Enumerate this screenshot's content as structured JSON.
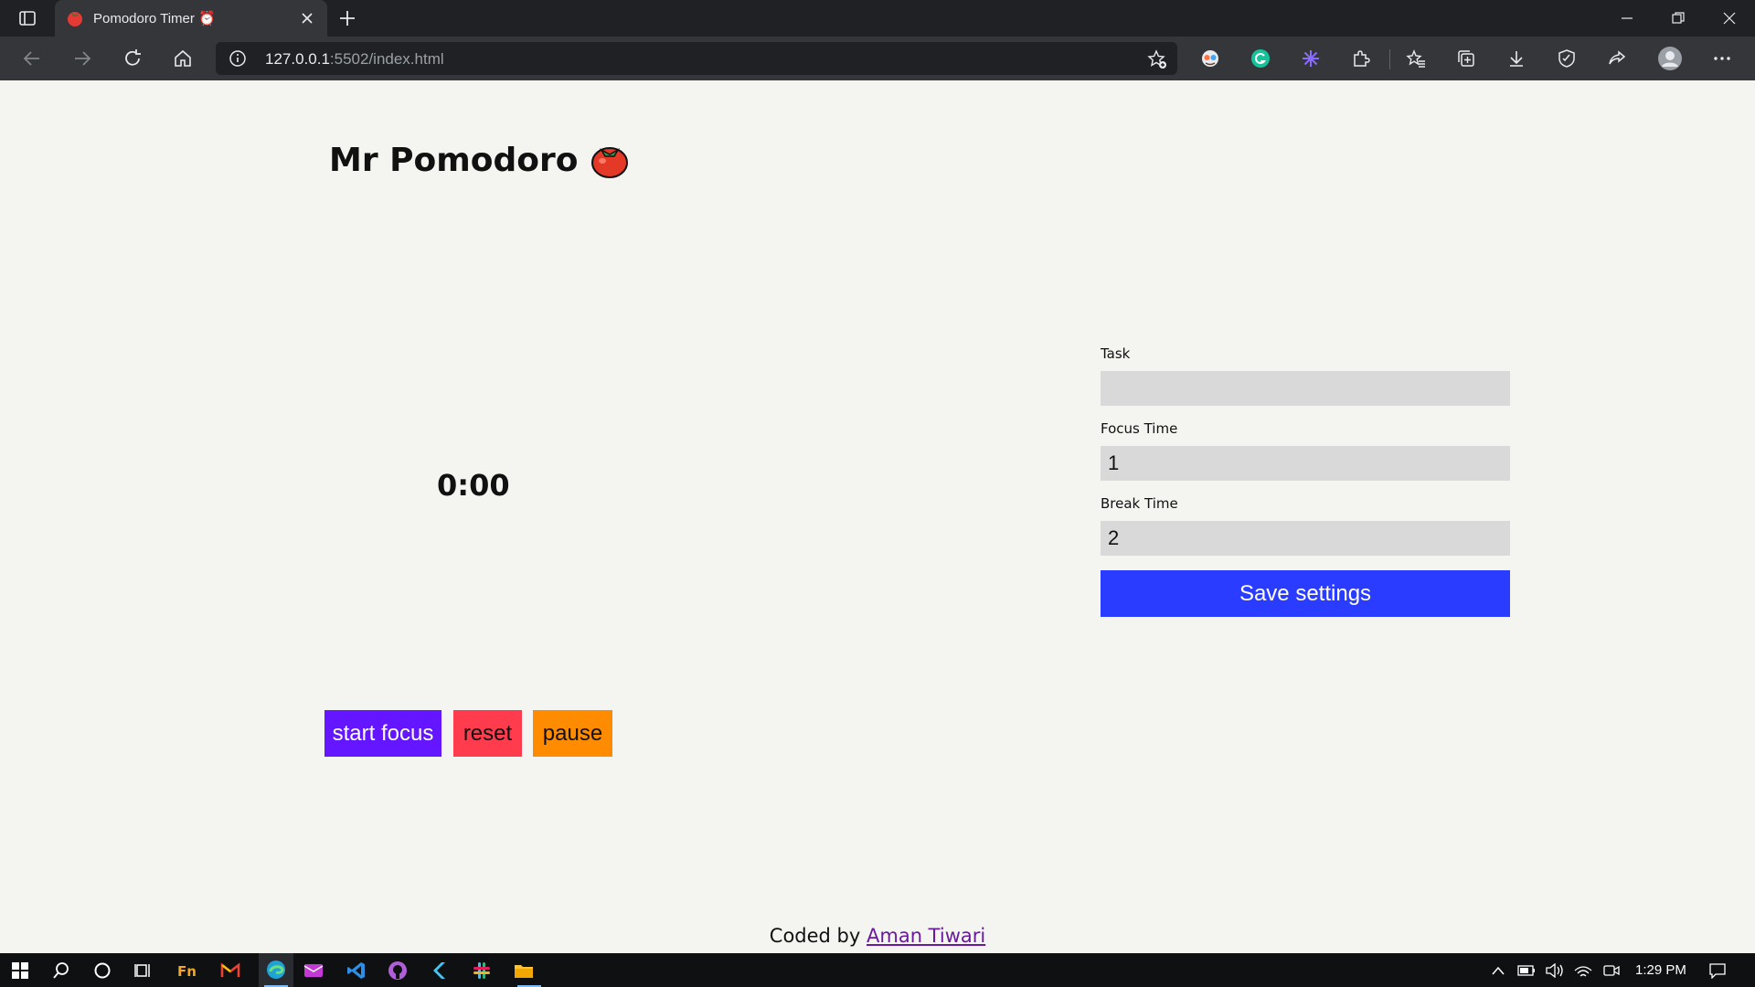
{
  "browser": {
    "tab_title": "Pomodoro Timer ⏰",
    "url_host": "127.0.0.1",
    "url_rest": ":5502/index.html"
  },
  "app": {
    "title": "Mr Pomodoro",
    "timer": "0:00",
    "buttons": {
      "start": "start focus",
      "reset": "reset",
      "pause": "pause"
    },
    "settings": {
      "task_label": "Task",
      "task_value": "",
      "focus_label": "Focus Time",
      "focus_value": "1",
      "break_label": "Break Time",
      "break_value": "2",
      "save_label": "Save settings"
    },
    "footer": {
      "prefix": "Coded by",
      "author": "Aman Tiwari"
    },
    "colors": {
      "start": "#6316ff",
      "reset": "#ff3b4e",
      "pause": "#ff8c00",
      "save": "#2a3cff"
    }
  },
  "taskbar": {
    "time": "1:29 PM"
  },
  "icons": [
    "tab-actions-icon",
    "tomato-icon",
    "close-icon",
    "plus-icon",
    "minimize-icon",
    "restore-icon",
    "back-icon",
    "forward-icon",
    "refresh-icon",
    "home-icon",
    "info-icon",
    "favorite-add-icon",
    "grammarly-icon",
    "extensions-icon",
    "favorites-icon",
    "collections-icon",
    "download-icon",
    "share-icon",
    "profile-icon",
    "more-icon",
    "windows-start-icon",
    "search-icon",
    "cortana-icon",
    "task-view-icon"
  ]
}
